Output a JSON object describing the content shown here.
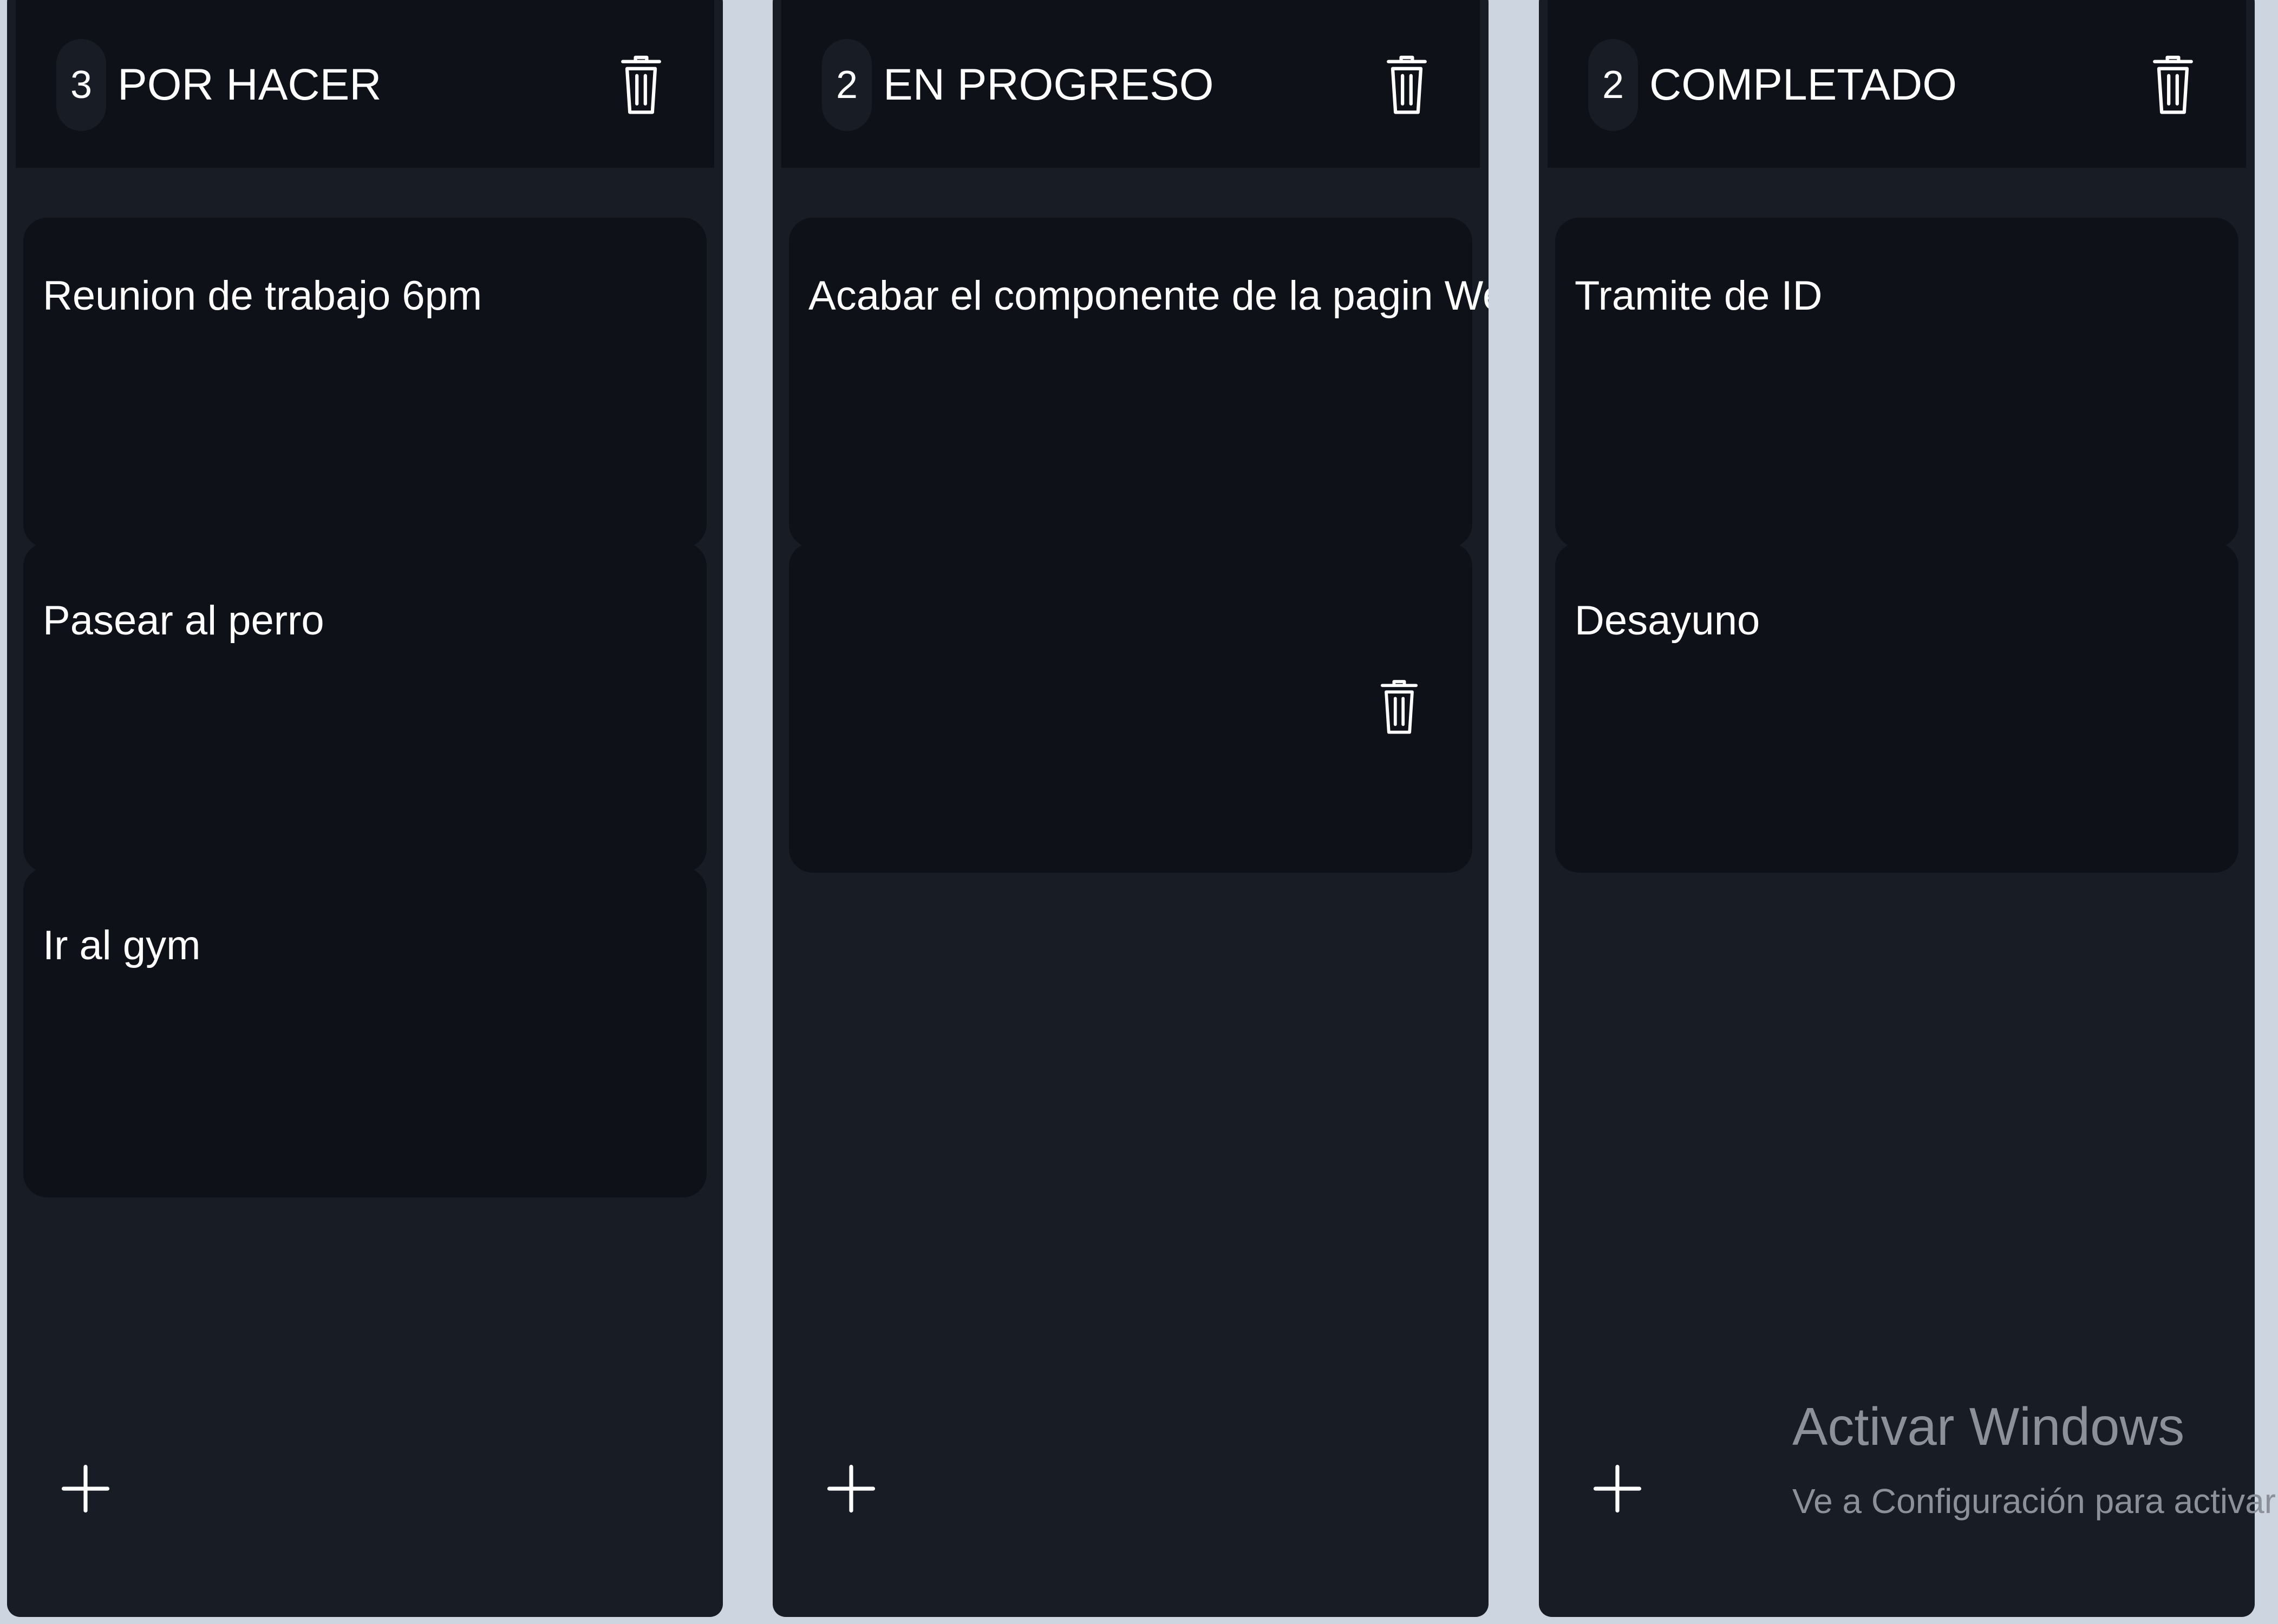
{
  "board": {
    "columns": [
      {
        "count": "3",
        "title": "POR HACER",
        "cards": [
          "Reunion de trabajo 6pm",
          "Pasear al perro",
          "Ir al gym"
        ]
      },
      {
        "count": "2",
        "title": "EN PROGRESO",
        "cards": [
          "Acabar el componente de la pagin Web",
          ""
        ]
      },
      {
        "count": "2",
        "title": "COMPLETADO",
        "cards": [
          "Tramite de ID",
          "Desayuno"
        ]
      }
    ]
  },
  "icons": {
    "delete": "trash-icon",
    "add": "plus-icon"
  },
  "watermark": {
    "title": "Activar Windows",
    "subtitle": "Ve a Configuración para activar Windows."
  },
  "colors": {
    "page_background": "#cdd5e0",
    "column_background": "#181c24",
    "header_and_card_background": "#0e1118",
    "text": "#ffffff",
    "watermark_text": "#8b9099"
  }
}
